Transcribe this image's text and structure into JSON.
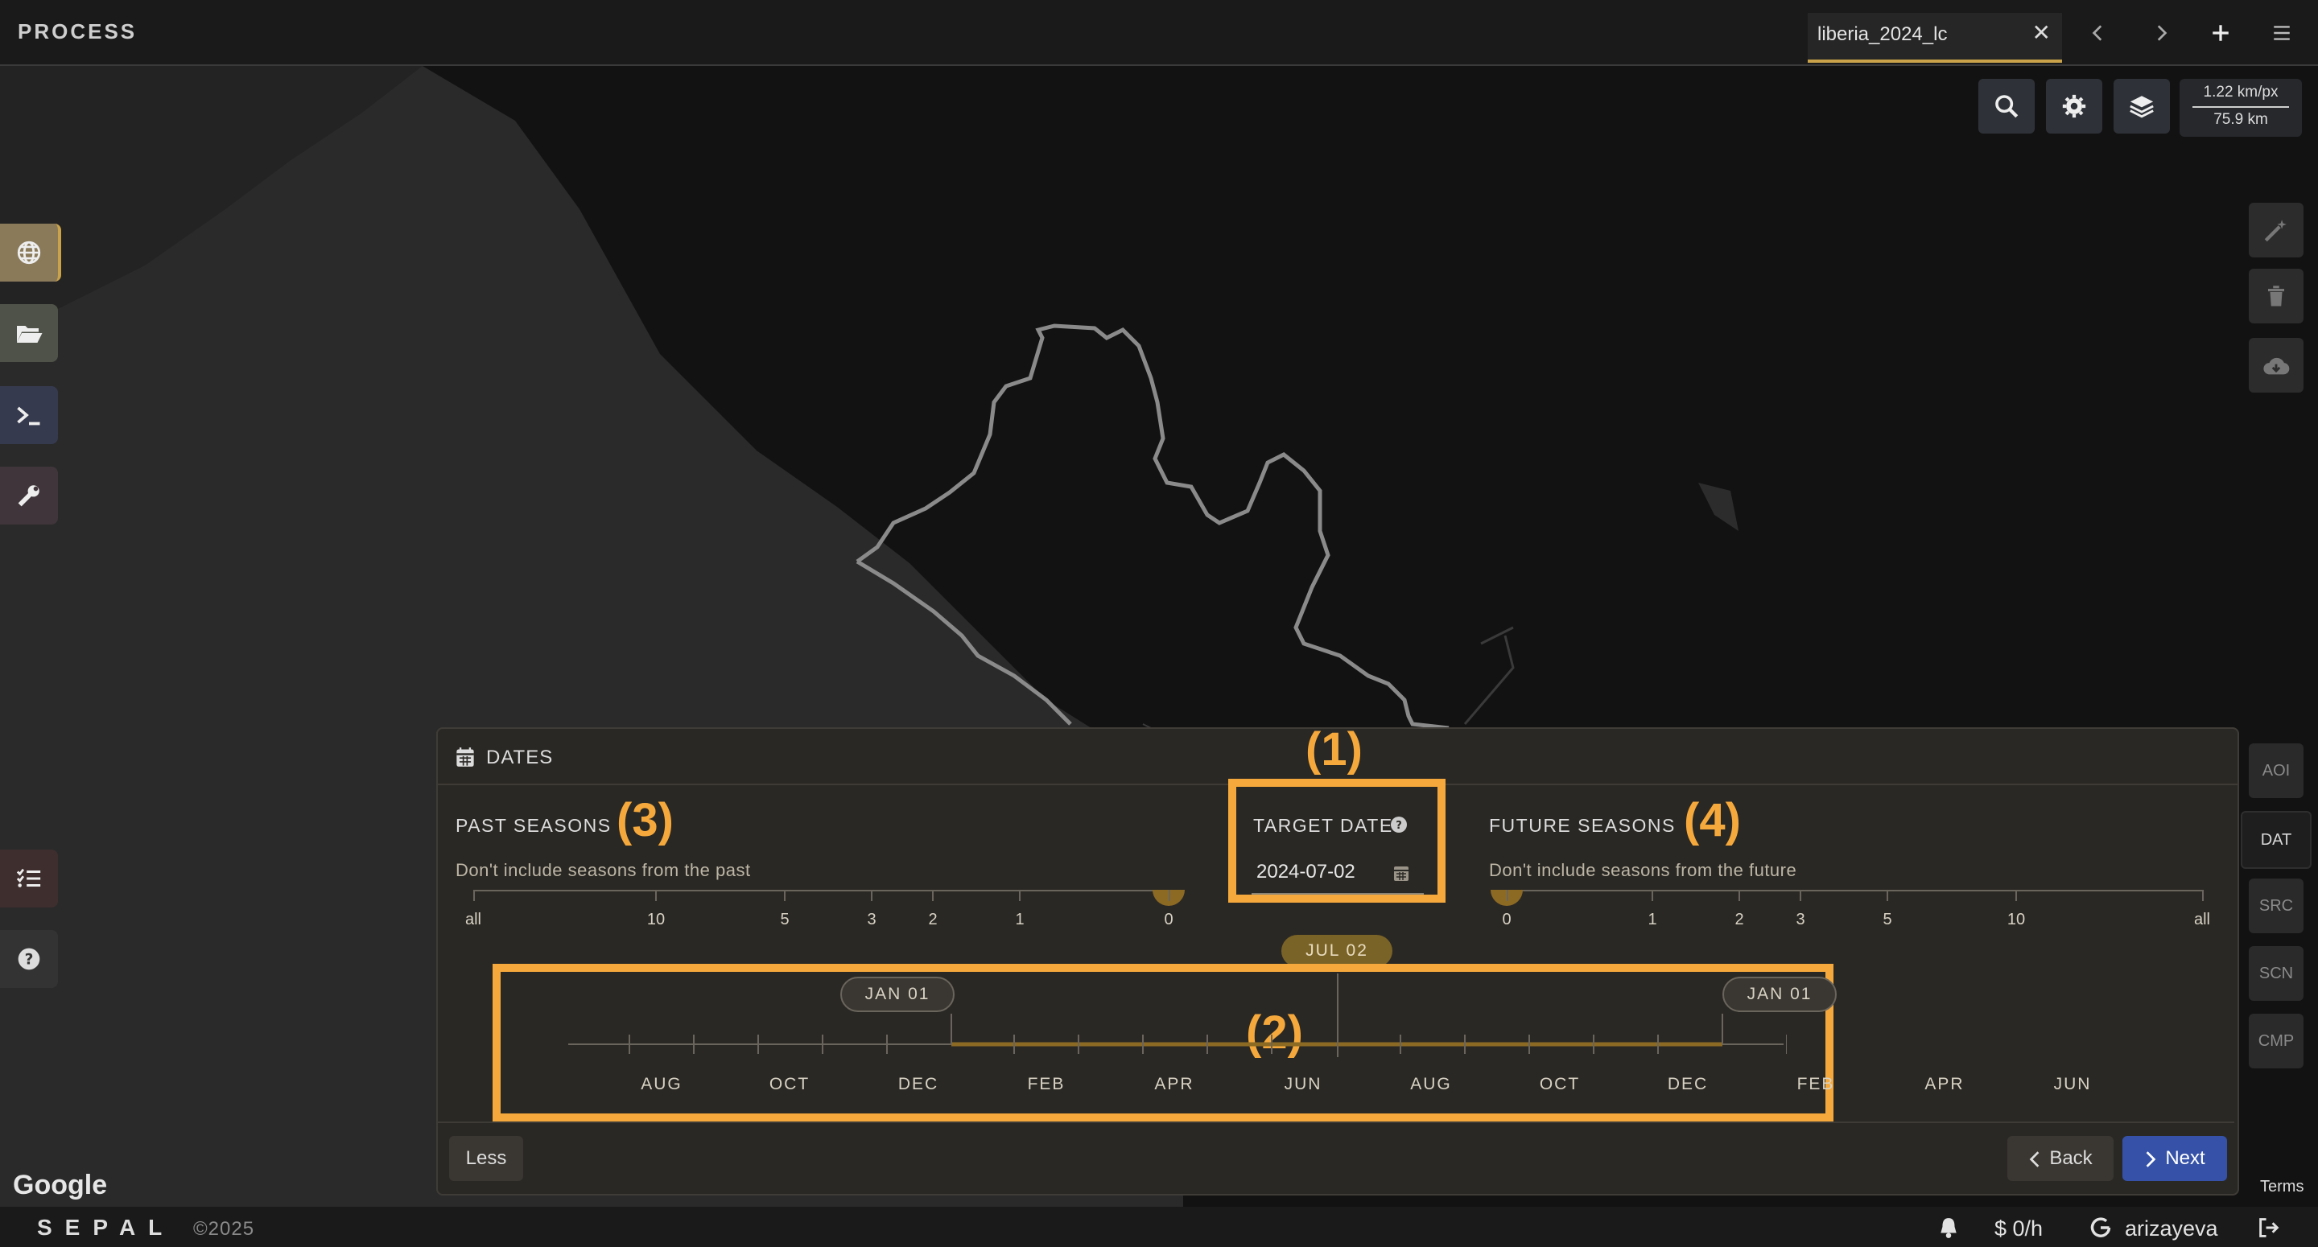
{
  "app": {
    "title": "PROCESS"
  },
  "tab": {
    "label": "liberia_2024_lc",
    "close": "✕"
  },
  "top_icons": {
    "prev": "chevron-left-icon",
    "next": "chevron-right-icon",
    "add": "plus-icon",
    "menu": "hamburger-icon"
  },
  "map_toolbar": {
    "scale_px": "1.22 km/px",
    "scale_dist": "75.9 km"
  },
  "left_sidebar": [
    "globe-icon",
    "folder-open-icon",
    "terminal-icon",
    "wrench-icon",
    "tasks-icon",
    "help-icon"
  ],
  "right_toolbar": [
    "magic-wand-icon",
    "trash-icon",
    "cloud-download-icon"
  ],
  "section_nav": [
    {
      "label": "AOI",
      "active": false
    },
    {
      "label": "DAT",
      "active": true
    },
    {
      "label": "SRC",
      "active": false
    },
    {
      "label": "SCN",
      "active": false
    },
    {
      "label": "CMP",
      "active": false
    }
  ],
  "dates_panel": {
    "title": "DATES",
    "past": {
      "label": "PAST SEASONS",
      "description": "Don't include seasons from the past",
      "ticks": [
        "all",
        "10",
        "5",
        "3",
        "2",
        "1",
        "0"
      ],
      "value": "0"
    },
    "target": {
      "label": "TARGET DATE",
      "value": "2024-07-02",
      "marker": "JUL 02"
    },
    "future": {
      "label": "FUTURE SEASONS",
      "description": "Don't include seasons from the future",
      "ticks": [
        "0",
        "1",
        "2",
        "3",
        "5",
        "10",
        "all"
      ],
      "value": "0"
    },
    "timeline": {
      "start_marker": "JAN 01",
      "end_marker": "JAN 01",
      "months": [
        "AUG",
        "OCT",
        "DEC",
        "FEB",
        "APR",
        "JUN",
        "AUG",
        "OCT",
        "DEC",
        "FEB",
        "APR",
        "JUN"
      ]
    },
    "annotations": {
      "target": "(1)",
      "timeline": "(2)",
      "past": "(3)",
      "future": "(4)"
    },
    "buttons": {
      "less": "Less",
      "back": "Back",
      "next": "Next"
    }
  },
  "map_attribution": {
    "google": "Google",
    "terms": "Terms"
  },
  "footer": {
    "brand": "SEPAL",
    "copyright": "©2025",
    "cost": "$ 0/h",
    "user": "arizayeva"
  },
  "colors": {
    "accent": "#f5a93c",
    "primary": "#3552a8",
    "panel": "#2a2824"
  }
}
